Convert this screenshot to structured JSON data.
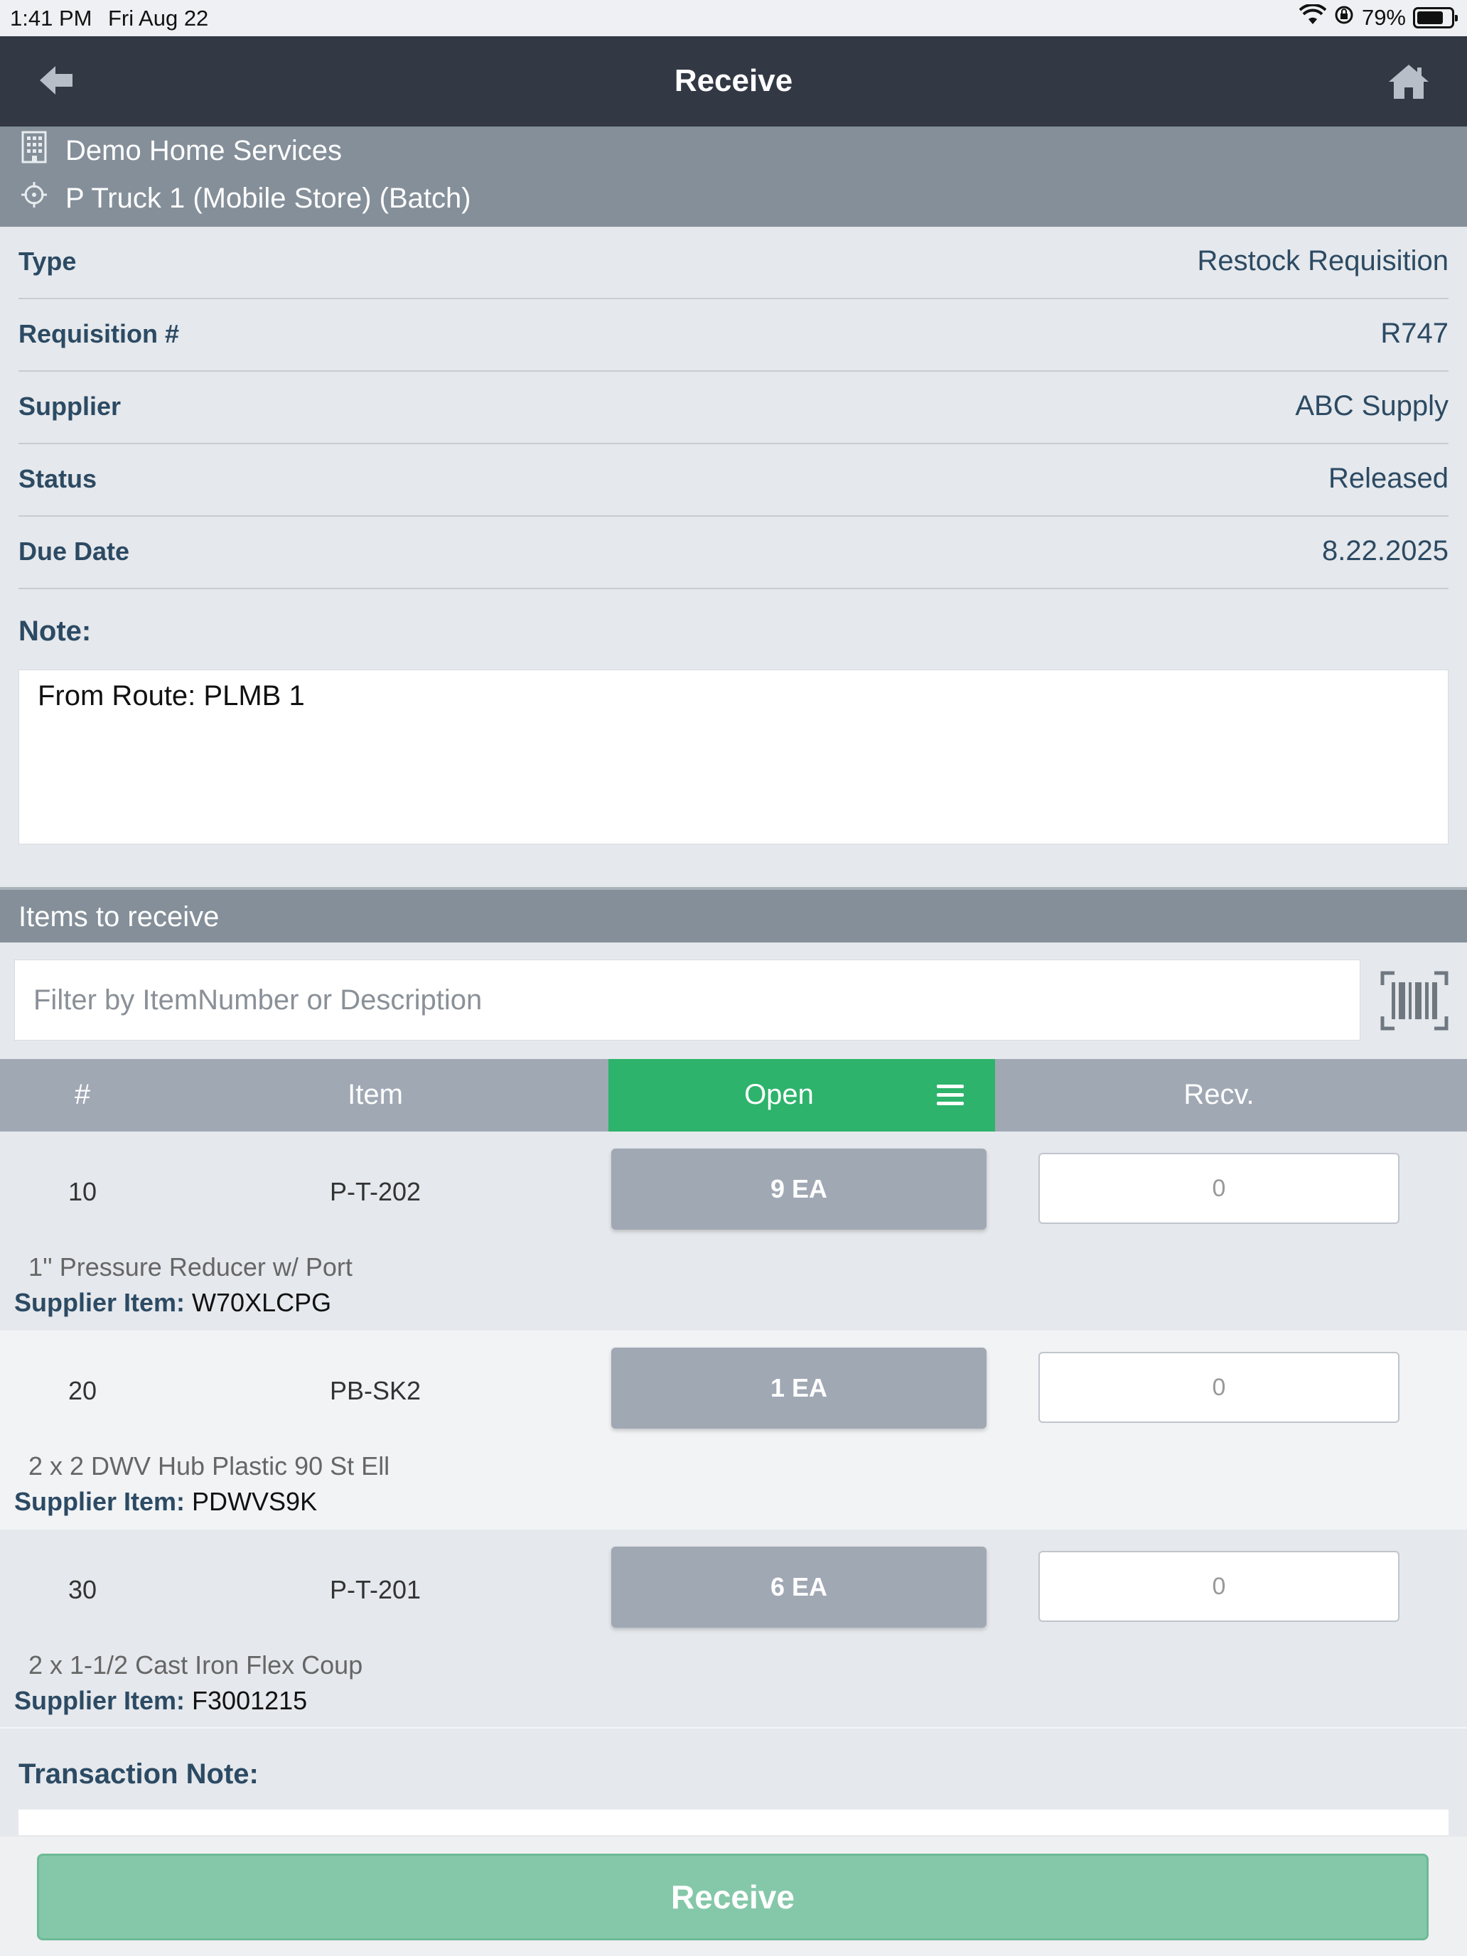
{
  "status_bar": {
    "time": "1:41 PM",
    "date": "Fri Aug 22",
    "battery": "79%",
    "battery_level": 0.79
  },
  "nav": {
    "title": "Receive",
    "back_icon": "back-arrow-icon",
    "home_icon": "home-icon"
  },
  "location": {
    "company": "Demo Home Services",
    "store": "P Truck 1 (Mobile Store) (Batch)"
  },
  "details": [
    {
      "label": "Type",
      "value": "Restock Requisition"
    },
    {
      "label": "Requisition #",
      "value": "R747"
    },
    {
      "label": "Supplier",
      "value": "ABC Supply"
    },
    {
      "label": "Status",
      "value": "Released"
    },
    {
      "label": "Due Date",
      "value": "8.22.2025"
    }
  ],
  "note": {
    "label": "Note:",
    "text": "From Route: PLMB 1"
  },
  "items_section": {
    "title": "Items to receive",
    "filter_placeholder": "Filter by ItemNumber or Description"
  },
  "table": {
    "headers": {
      "num": "#",
      "item": "Item",
      "open": "Open",
      "recv": "Recv."
    },
    "rows": [
      {
        "num": "10",
        "item": "P-T-202",
        "open": "9 EA",
        "recv": "0",
        "desc": "1'' Pressure Reducer w/ Port",
        "supplier_label": "Supplier Item:",
        "supplier_item": "W70XLCPG"
      },
      {
        "num": "20",
        "item": "PB-SK2",
        "open": "1 EA",
        "recv": "0",
        "desc": "2 x 2 DWV Hub Plastic 90 St Ell",
        "supplier_label": "Supplier Item:",
        "supplier_item": "PDWVS9K"
      },
      {
        "num": "30",
        "item": "P-T-201",
        "open": "6 EA",
        "recv": "0",
        "desc": "2 x 1-1/2 Cast Iron Flex Coup",
        "supplier_label": "Supplier Item:",
        "supplier_item": "F3001215"
      }
    ]
  },
  "transaction_note": {
    "label": "Transaction Note:"
  },
  "receive_button": "Receive",
  "colors": {
    "navbar": "#323844",
    "header_gray": "#848f99",
    "accent_green": "#2db36b",
    "button_disabled_green": "#85c8a9"
  }
}
